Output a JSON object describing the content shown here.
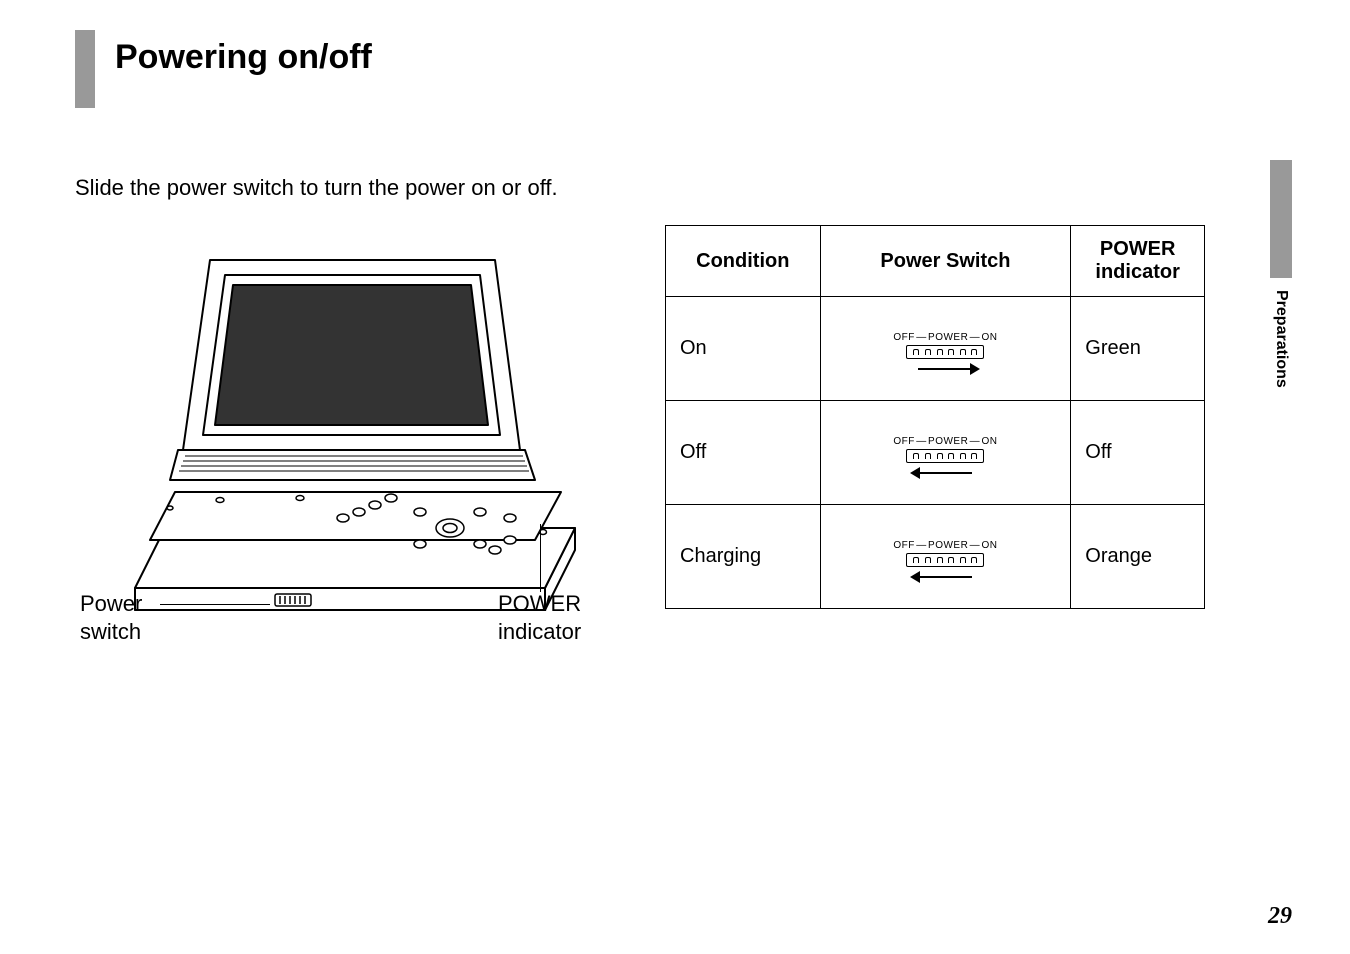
{
  "page_title": "Powering on/off",
  "intro_text": "Slide the power switch to turn the power on or off.",
  "device_labels": {
    "power_switch": "Power\nswitch",
    "power_indicator": "POWER\nindicator"
  },
  "switch_label": {
    "off": "OFF",
    "power": "POWER",
    "on": "ON"
  },
  "table": {
    "headers": {
      "condition": "Condition",
      "power_switch": "Power Switch",
      "power_indicator": "POWER indicator"
    },
    "rows": [
      {
        "condition": "On",
        "arrow": "right",
        "indicator": "Green"
      },
      {
        "condition": "Off",
        "arrow": "left",
        "indicator": "Off"
      },
      {
        "condition": "Charging",
        "arrow": "left",
        "indicator": "Orange"
      }
    ]
  },
  "section_tab": "Preparations",
  "page_number": "29"
}
